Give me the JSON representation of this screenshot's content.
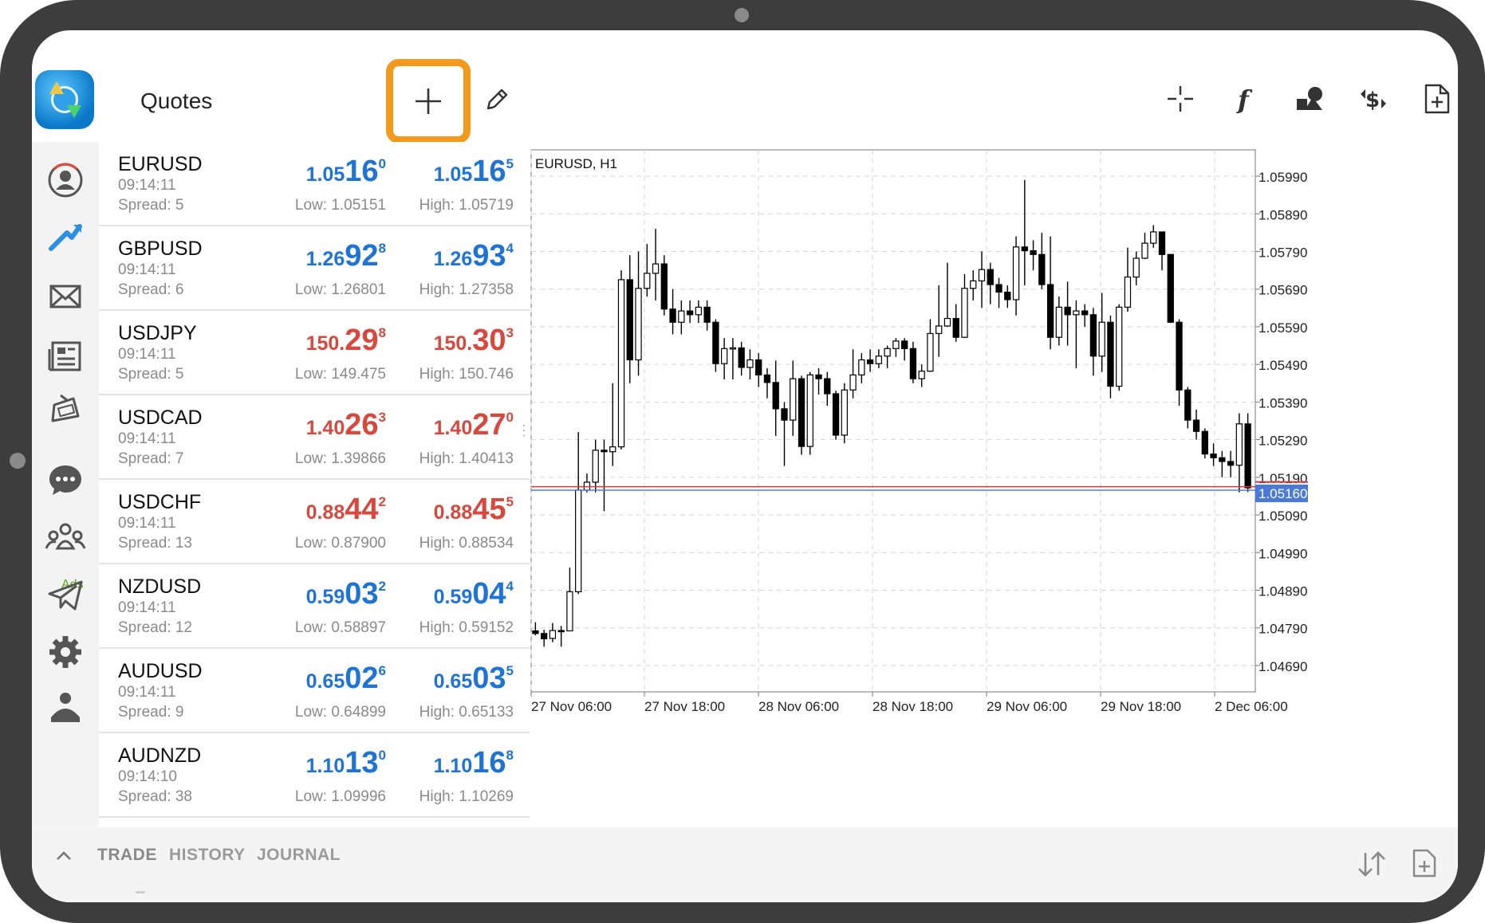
{
  "header": {
    "title": "Quotes"
  },
  "nav": {
    "items": [
      "account-icon",
      "trade-icon",
      "mail-icon",
      "news-icon",
      "ads-icon",
      "chat-icon",
      "community-icon",
      "telegram-icon",
      "settings-icon",
      "traders-icon"
    ],
    "ads_label": "Ads"
  },
  "toolbar": {
    "add_icon": "plus-icon",
    "edit_icon": "pencil-icon",
    "right_icons": [
      "crosshair-icon",
      "indicators-icon",
      "objects-icon",
      "trade-dollar-icon",
      "new-order-icon"
    ],
    "highlight_color": "#f39a1c"
  },
  "quotes": [
    {
      "symbol": "EURUSD",
      "time": "09:14:11",
      "spread": "Spread: 5",
      "color": "blue",
      "bid": {
        "pre": "1.05",
        "big": "16",
        "sup": "0"
      },
      "ask": {
        "pre": "1.05",
        "big": "16",
        "sup": "5"
      },
      "low": "Low: 1.05151",
      "high": "High: 1.05719"
    },
    {
      "symbol": "GBPUSD",
      "time": "09:14:11",
      "spread": "Spread: 6",
      "color": "blue",
      "bid": {
        "pre": "1.26",
        "big": "92",
        "sup": "8"
      },
      "ask": {
        "pre": "1.26",
        "big": "93",
        "sup": "4"
      },
      "low": "Low: 1.26801",
      "high": "High: 1.27358"
    },
    {
      "symbol": "USDJPY",
      "time": "09:14:11",
      "spread": "Spread: 5",
      "color": "red",
      "bid": {
        "pre": "150.",
        "big": "29",
        "sup": "8"
      },
      "ask": {
        "pre": "150.",
        "big": "30",
        "sup": "3"
      },
      "low": "Low: 149.475",
      "high": "High: 150.746"
    },
    {
      "symbol": "USDCAD",
      "time": "09:14:11",
      "spread": "Spread: 7",
      "color": "red",
      "bid": {
        "pre": "1.40",
        "big": "26",
        "sup": "3"
      },
      "ask": {
        "pre": "1.40",
        "big": "27",
        "sup": "0"
      },
      "low": "Low: 1.39866",
      "high": "High: 1.40413"
    },
    {
      "symbol": "USDCHF",
      "time": "09:14:11",
      "spread": "Spread: 13",
      "color": "red",
      "bid": {
        "pre": "0.88",
        "big": "44",
        "sup": "2"
      },
      "ask": {
        "pre": "0.88",
        "big": "45",
        "sup": "5"
      },
      "low": "Low: 0.87900",
      "high": "High: 0.88534"
    },
    {
      "symbol": "NZDUSD",
      "time": "09:14:11",
      "spread": "Spread: 12",
      "color": "blue",
      "bid": {
        "pre": "0.59",
        "big": "03",
        "sup": "2"
      },
      "ask": {
        "pre": "0.59",
        "big": "04",
        "sup": "4"
      },
      "low": "Low: 0.58897",
      "high": "High: 0.59152"
    },
    {
      "symbol": "AUDUSD",
      "time": "09:14:11",
      "spread": "Spread: 9",
      "color": "blue",
      "bid": {
        "pre": "0.65",
        "big": "02",
        "sup": "6"
      },
      "ask": {
        "pre": "0.65",
        "big": "03",
        "sup": "5"
      },
      "low": "Low: 0.64899",
      "high": "High: 0.65133"
    },
    {
      "symbol": "AUDNZD",
      "time": "09:14:10",
      "spread": "Spread: 38",
      "color": "blue",
      "bid": {
        "pre": "1.10",
        "big": "13",
        "sup": "0"
      },
      "ask": {
        "pre": "1.10",
        "big": "16",
        "sup": "8"
      },
      "low": "Low: 1.09996",
      "high": "High: 1.10269"
    }
  ],
  "chart_data": {
    "type": "candlestick",
    "title": "EURUSD, H1",
    "y_ticks": [
      "1.05990",
      "1.05890",
      "1.05790",
      "1.05690",
      "1.05590",
      "1.05490",
      "1.05390",
      "1.05290",
      "1.05190",
      "1.05090",
      "1.04990",
      "1.04890",
      "1.04790",
      "1.04690"
    ],
    "ylim": [
      1.0462,
      1.0606
    ],
    "x_ticks": [
      "27 Nov 06:00",
      "27 Nov 18:00",
      "28 Nov 06:00",
      "28 Nov 18:00",
      "29 Nov 06:00",
      "29 Nov 18:00",
      "2 Dec 06:00"
    ],
    "current_price": "1.05160",
    "bid_line": 1.0516,
    "ask_line": 1.05165,
    "grid": true,
    "candles": [
      [
        1.04782,
        1.04775,
        1.04805,
        1.0477
      ],
      [
        1.04775,
        1.04761,
        1.04785,
        1.0474
      ],
      [
        1.04762,
        1.04783,
        1.04803,
        1.04752
      ],
      [
        1.04783,
        1.04782,
        1.04795,
        1.0474
      ],
      [
        1.04782,
        1.04886,
        1.0495,
        1.04782
      ],
      [
        1.04886,
        1.05156,
        1.0531,
        1.0488
      ],
      [
        1.05156,
        1.05177,
        1.052,
        1.0515
      ],
      [
        1.05177,
        1.05262,
        1.0529,
        1.0515
      ],
      [
        1.05262,
        1.05258,
        1.0529,
        1.051
      ],
      [
        1.05258,
        1.05271,
        1.0544,
        1.0522
      ],
      [
        1.05271,
        1.05715,
        1.0574,
        1.05264
      ],
      [
        1.05715,
        1.05502,
        1.0578,
        1.0544
      ],
      [
        1.05502,
        1.05692,
        1.0579,
        1.0546
      ],
      [
        1.05692,
        1.05732,
        1.0581,
        1.0567
      ],
      [
        1.05732,
        1.05757,
        1.0585,
        1.0566
      ],
      [
        1.05757,
        1.05637,
        1.0578,
        1.0562
      ],
      [
        1.05637,
        1.05602,
        1.0569,
        1.0557
      ],
      [
        1.05602,
        1.05632,
        1.0566,
        1.0557
      ],
      [
        1.05632,
        1.05622,
        1.0566,
        1.056
      ],
      [
        1.05622,
        1.05642,
        1.0566,
        1.056
      ],
      [
        1.05642,
        1.05602,
        1.0566,
        1.0558
      ],
      [
        1.05602,
        1.05492,
        1.0561,
        1.0547
      ],
      [
        1.05492,
        1.05532,
        1.0556,
        1.0545
      ],
      [
        1.05532,
        1.05534,
        1.0556,
        1.0545
      ],
      [
        1.05534,
        1.05482,
        1.0555,
        1.0546
      ],
      [
        1.05482,
        1.05502,
        1.0553,
        1.0545
      ],
      [
        1.05502,
        1.05462,
        1.0552,
        1.0543
      ],
      [
        1.05462,
        1.05442,
        1.0548,
        1.054
      ],
      [
        1.05442,
        1.05372,
        1.055,
        1.053
      ],
      [
        1.05372,
        1.05342,
        1.0539,
        1.0522
      ],
      [
        1.05342,
        1.05452,
        1.055,
        1.053
      ],
      [
        1.05452,
        1.05272,
        1.0546,
        1.0525
      ],
      [
        1.05272,
        1.05462,
        1.0547,
        1.0525
      ],
      [
        1.05462,
        1.05452,
        1.0548,
        1.0541
      ],
      [
        1.05452,
        1.05412,
        1.0547,
        1.0538
      ],
      [
        1.05412,
        1.05302,
        1.0542,
        1.0529
      ],
      [
        1.05302,
        1.05422,
        1.0544,
        1.0528
      ],
      [
        1.05422,
        1.05462,
        1.0553,
        1.054
      ],
      [
        1.05462,
        1.05502,
        1.0552,
        1.0544
      ],
      [
        1.05502,
        1.05492,
        1.0553,
        1.0547
      ],
      [
        1.05492,
        1.05512,
        1.0553,
        1.0548
      ],
      [
        1.05512,
        1.05532,
        1.0554,
        1.0548
      ],
      [
        1.05532,
        1.05552,
        1.0556,
        1.0551
      ],
      [
        1.05552,
        1.05532,
        1.0556,
        1.055
      ],
      [
        1.05532,
        1.05452,
        1.0555,
        1.0544
      ],
      [
        1.05452,
        1.05472,
        1.0549,
        1.0543
      ],
      [
        1.05472,
        1.05572,
        1.0561,
        1.0547
      ],
      [
        1.05572,
        1.05592,
        1.057,
        1.0551
      ],
      [
        1.05592,
        1.05612,
        1.0576,
        1.0559
      ],
      [
        1.05612,
        1.05562,
        1.0565,
        1.0555
      ],
      [
        1.05562,
        1.05692,
        1.0573,
        1.0556
      ],
      [
        1.05692,
        1.05712,
        1.0574,
        1.0566
      ],
      [
        1.05712,
        1.05742,
        1.0579,
        1.0564
      ],
      [
        1.05742,
        1.05702,
        1.0576,
        1.0565
      ],
      [
        1.05702,
        1.05682,
        1.0572,
        1.0564
      ],
      [
        1.05682,
        1.05662,
        1.057,
        1.0564
      ],
      [
        1.05662,
        1.05802,
        1.0583,
        1.0562
      ],
      [
        1.05802,
        1.05792,
        1.0598,
        1.057
      ],
      [
        1.05792,
        1.05782,
        1.0582,
        1.0574
      ],
      [
        1.05782,
        1.05702,
        1.0584,
        1.0569
      ],
      [
        1.05702,
        1.05562,
        1.0583,
        1.0553
      ],
      [
        1.05562,
        1.05642,
        1.0567,
        1.0554
      ],
      [
        1.05642,
        1.05622,
        1.0571,
        1.0554
      ],
      [
        1.05622,
        1.05632,
        1.0566,
        1.0548
      ],
      [
        1.05632,
        1.05622,
        1.0565,
        1.0559
      ],
      [
        1.05622,
        1.05512,
        1.0564,
        1.0546
      ],
      [
        1.05512,
        1.05602,
        1.0568,
        1.0547
      ],
      [
        1.05602,
        1.05432,
        1.0562,
        1.054
      ],
      [
        1.05432,
        1.05642,
        1.0565,
        1.0542
      ],
      [
        1.05642,
        1.05722,
        1.058,
        1.0563
      ],
      [
        1.05722,
        1.05772,
        1.0579,
        1.057
      ],
      [
        1.05772,
        1.05812,
        1.0584,
        1.0577
      ],
      [
        1.05812,
        1.05842,
        1.0586,
        1.058
      ],
      [
        1.05842,
        1.05782,
        1.0584,
        1.0574
      ],
      [
        1.05782,
        1.05602,
        1.0565,
        1.056
      ],
      [
        1.05602,
        1.05422,
        1.0561,
        1.0538
      ],
      [
        1.05422,
        1.05342,
        1.0543,
        1.0532
      ],
      [
        1.05342,
        1.05312,
        1.0537,
        1.0529
      ],
      [
        1.05312,
        1.05252,
        1.0532,
        1.0524
      ],
      [
        1.05252,
        1.05242,
        1.0528,
        1.0522
      ],
      [
        1.05242,
        1.05232,
        1.0526,
        1.0519
      ],
      [
        1.05232,
        1.05222,
        1.0526,
        1.0519
      ],
      [
        1.05222,
        1.05332,
        1.0536,
        1.0515
      ],
      [
        1.05332,
        1.05162,
        1.0536,
        1.05151
      ]
    ]
  },
  "bottom": {
    "tabs": [
      "TRADE",
      "HISTORY",
      "JOURNAL"
    ],
    "active": "TRADE"
  }
}
